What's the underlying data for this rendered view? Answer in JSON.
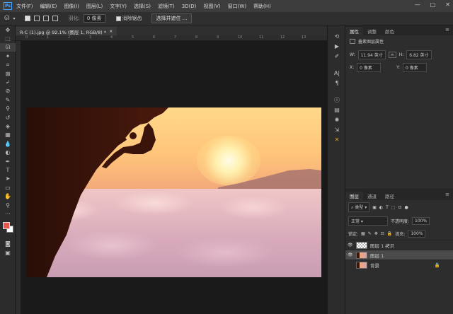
{
  "menubar": {
    "logo": "Ps",
    "items": [
      "文件(F)",
      "编辑(E)",
      "图像(I)",
      "图层(L)",
      "文字(Y)",
      "选择(S)",
      "滤镜(T)",
      "3D(D)",
      "视图(V)",
      "窗口(W)",
      "帮助(H)"
    ],
    "controls": [
      "—",
      "□",
      "✕"
    ]
  },
  "options": {
    "feather_label": "羽化:",
    "feather_value": "0 像素",
    "antialias_label": "消除锯齿",
    "select_mask_button": "选择并遮住 ..."
  },
  "document_tab": {
    "title": "R-C (1).jpg @ 92.1% (图层 1, RGB/8) *",
    "close": "×"
  },
  "ruler_ticks": [
    "0",
    "1",
    "2",
    "3",
    "4",
    "5",
    "6",
    "7",
    "8",
    "9",
    "10",
    "11",
    "12",
    "13"
  ],
  "properties_panel": {
    "tabs": [
      "属性",
      "调整",
      "颜色"
    ],
    "header": "叠素图层属性",
    "w_label": "W:",
    "w_value": "11.94 英寸",
    "link_icon": "∞",
    "h_label": "H:",
    "h_value": "6.82 英寸",
    "x_label": "X:",
    "x_value": "0 像素",
    "y_label": "Y:",
    "y_value": "0 像素"
  },
  "layers_panel": {
    "tabs": [
      "图层",
      "通道",
      "路径"
    ],
    "filter_kind": "类型",
    "blend_mode": "正常",
    "opacity_label": "不透明度:",
    "opacity_value": "100%",
    "lock_label": "锁定:",
    "fill_label": "填充:",
    "fill_value": "100%",
    "layers": [
      {
        "name": "图层 1 拷贝",
        "visible": true,
        "selected": false
      },
      {
        "name": "图层 1",
        "visible": true,
        "selected": true
      },
      {
        "name": "背景",
        "visible": false,
        "selected": false,
        "locked": true
      }
    ]
  },
  "colors": {
    "foreground": "#e8564d",
    "background": "#ffffff",
    "accent": "#4aa3ff"
  }
}
